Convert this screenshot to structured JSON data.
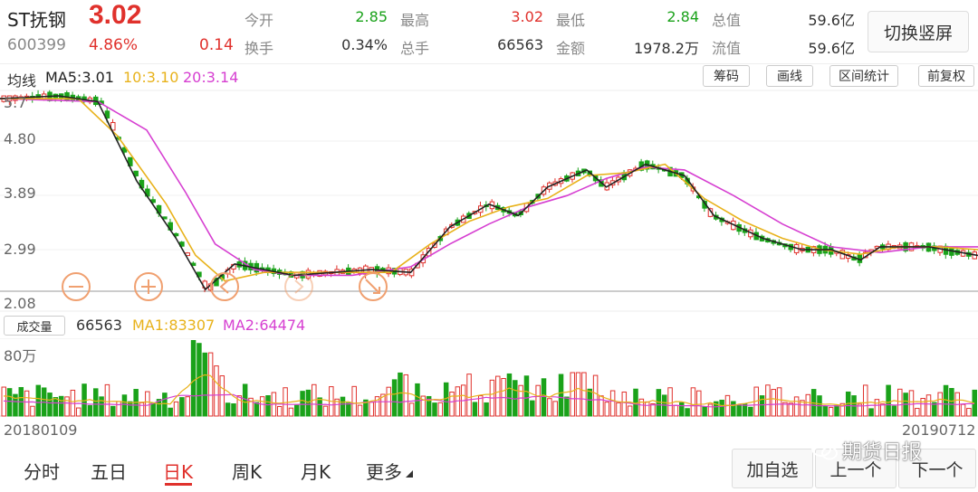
{
  "stock": {
    "name": "ST抚钢",
    "price": "3.02",
    "code": "600399",
    "pct": "4.86%",
    "change": "0.14"
  },
  "quote": {
    "open_label": "今开",
    "open": "2.85",
    "high_label": "最高",
    "high": "3.02",
    "low_label": "最低",
    "low": "2.84",
    "mcap_label": "总值",
    "mcap": "59.6亿",
    "turnover_label": "换手",
    "turnover": "0.34%",
    "vol_label": "总手",
    "vol": "66563",
    "amount_label": "金额",
    "amount": "1978.2万",
    "float_label": "流值",
    "float": "59.6亿"
  },
  "switch_label": "切换竖屏",
  "ma_legend": {
    "base": "均线",
    "ma5": "MA5:3.01",
    "ma10": "10:3.10",
    "ma20": "20:3.14"
  },
  "tools": {
    "chips": "筹码",
    "draw": "画线",
    "range": "区间统计",
    "adjust": "前复权"
  },
  "price_axis": [
    "5.7",
    "4.80",
    "3.89",
    "2.99",
    "2.08"
  ],
  "volume": {
    "button": "成交量",
    "value": "66563",
    "ma1": "MA1:83307",
    "ma2": "MA2:64474",
    "axis_top": "80万"
  },
  "dates": {
    "start": "20180109",
    "end": "20190712"
  },
  "nav": {
    "tabs": [
      "分时",
      "五日",
      "日K",
      "周K",
      "月K",
      "更多"
    ],
    "add": "加自选",
    "prev": "上一个",
    "next": "下一个"
  },
  "watermark": "期货日报",
  "colors": {
    "up": "#e0312c",
    "down": "#1aa21a",
    "ma5": "#222222",
    "ma10": "#e8b21b",
    "ma20": "#d63fd1"
  },
  "chart_data": {
    "type": "candlestick",
    "y_range": [
      2.08,
      5.7
    ],
    "ma5_points": [
      [
        0,
        5.65
      ],
      [
        0.06,
        5.7
      ],
      [
        0.1,
        5.6
      ],
      [
        0.14,
        4.2
      ],
      [
        0.18,
        3.2
      ],
      [
        0.21,
        2.3
      ],
      [
        0.24,
        2.75
      ],
      [
        0.3,
        2.55
      ],
      [
        0.38,
        2.65
      ],
      [
        0.42,
        2.6
      ],
      [
        0.46,
        3.4
      ],
      [
        0.5,
        3.8
      ],
      [
        0.53,
        3.6
      ],
      [
        0.56,
        4.1
      ],
      [
        0.6,
        4.4
      ],
      [
        0.62,
        4.1
      ],
      [
        0.66,
        4.5
      ],
      [
        0.7,
        4.3
      ],
      [
        0.73,
        3.6
      ],
      [
        0.78,
        3.2
      ],
      [
        0.82,
        3.0
      ],
      [
        0.85,
        3.0
      ],
      [
        0.88,
        2.82
      ],
      [
        0.9,
        3.05
      ],
      [
        0.95,
        3.05
      ],
      [
        1.0,
        2.9
      ]
    ],
    "ma10_points": [
      [
        0,
        5.65
      ],
      [
        0.08,
        5.65
      ],
      [
        0.12,
        5.0
      ],
      [
        0.17,
        3.8
      ],
      [
        0.2,
        2.9
      ],
      [
        0.23,
        2.45
      ],
      [
        0.27,
        2.6
      ],
      [
        0.33,
        2.6
      ],
      [
        0.4,
        2.6
      ],
      [
        0.44,
        3.1
      ],
      [
        0.48,
        3.5
      ],
      [
        0.52,
        3.75
      ],
      [
        0.56,
        3.9
      ],
      [
        0.6,
        4.3
      ],
      [
        0.64,
        4.35
      ],
      [
        0.68,
        4.5
      ],
      [
        0.72,
        3.9
      ],
      [
        0.76,
        3.5
      ],
      [
        0.8,
        3.2
      ],
      [
        0.84,
        3.0
      ],
      [
        0.88,
        2.92
      ],
      [
        0.92,
        3.05
      ],
      [
        0.96,
        3.05
      ],
      [
        1.0,
        3.0
      ]
    ],
    "ma20_points": [
      [
        0,
        5.65
      ],
      [
        0.1,
        5.6
      ],
      [
        0.15,
        5.1
      ],
      [
        0.19,
        4.0
      ],
      [
        0.22,
        3.1
      ],
      [
        0.26,
        2.65
      ],
      [
        0.3,
        2.55
      ],
      [
        0.36,
        2.55
      ],
      [
        0.42,
        2.7
      ],
      [
        0.46,
        3.1
      ],
      [
        0.5,
        3.45
      ],
      [
        0.54,
        3.75
      ],
      [
        0.58,
        3.95
      ],
      [
        0.62,
        4.25
      ],
      [
        0.66,
        4.45
      ],
      [
        0.7,
        4.4
      ],
      [
        0.75,
        3.95
      ],
      [
        0.8,
        3.45
      ],
      [
        0.85,
        3.05
      ],
      [
        0.9,
        2.95
      ],
      [
        0.95,
        3.05
      ],
      [
        1.0,
        3.05
      ]
    ]
  }
}
